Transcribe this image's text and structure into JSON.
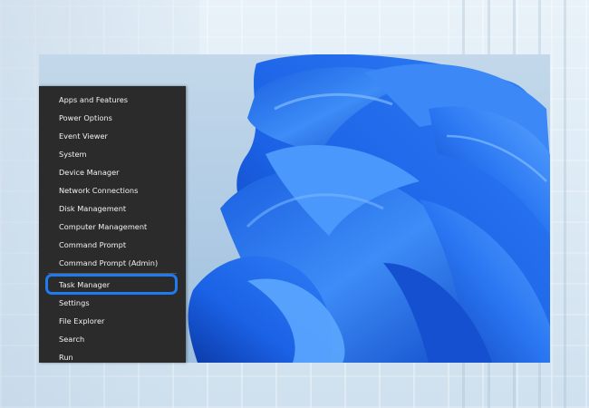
{
  "menu": {
    "items": [
      {
        "label": "Apps and Features"
      },
      {
        "label": "Power Options"
      },
      {
        "label": "Event Viewer"
      },
      {
        "label": "System"
      },
      {
        "label": "Device Manager"
      },
      {
        "label": "Network Connections"
      },
      {
        "label": "Disk Management"
      },
      {
        "label": "Computer Management"
      },
      {
        "label": "Command Prompt"
      },
      {
        "label": "Command Prompt (Admin)"
      },
      {
        "label": "Task Manager"
      },
      {
        "label": "Settings"
      },
      {
        "label": "File Explorer"
      },
      {
        "label": "Search"
      },
      {
        "label": "Run"
      }
    ],
    "highlighted_item": "Task Manager"
  },
  "colors": {
    "menu_background": "#2b2b2b",
    "menu_text": "#f2f2f2",
    "highlight_border": "#1e7bf0",
    "wallpaper_blue": "#1f6ff0"
  }
}
